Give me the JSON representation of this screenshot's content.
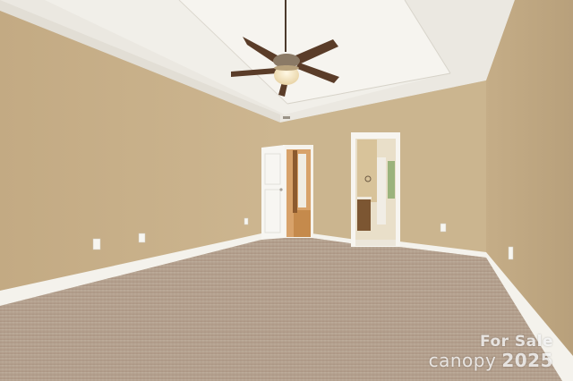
{
  "photo": {
    "scene": "empty bedroom with tray ceiling, ceiling fan, beige walls and carpet",
    "colors": {
      "wall": "#c8b08a",
      "wall_shadow": "#b9a07b",
      "ceiling": "#ece9e2",
      "carpet": "#b39f8d",
      "trim": "#f6f4ef",
      "fan_blade": "#5a3c28"
    }
  },
  "watermark": {
    "brand": "canopy",
    "status": "For Sale",
    "year": "2025"
  }
}
